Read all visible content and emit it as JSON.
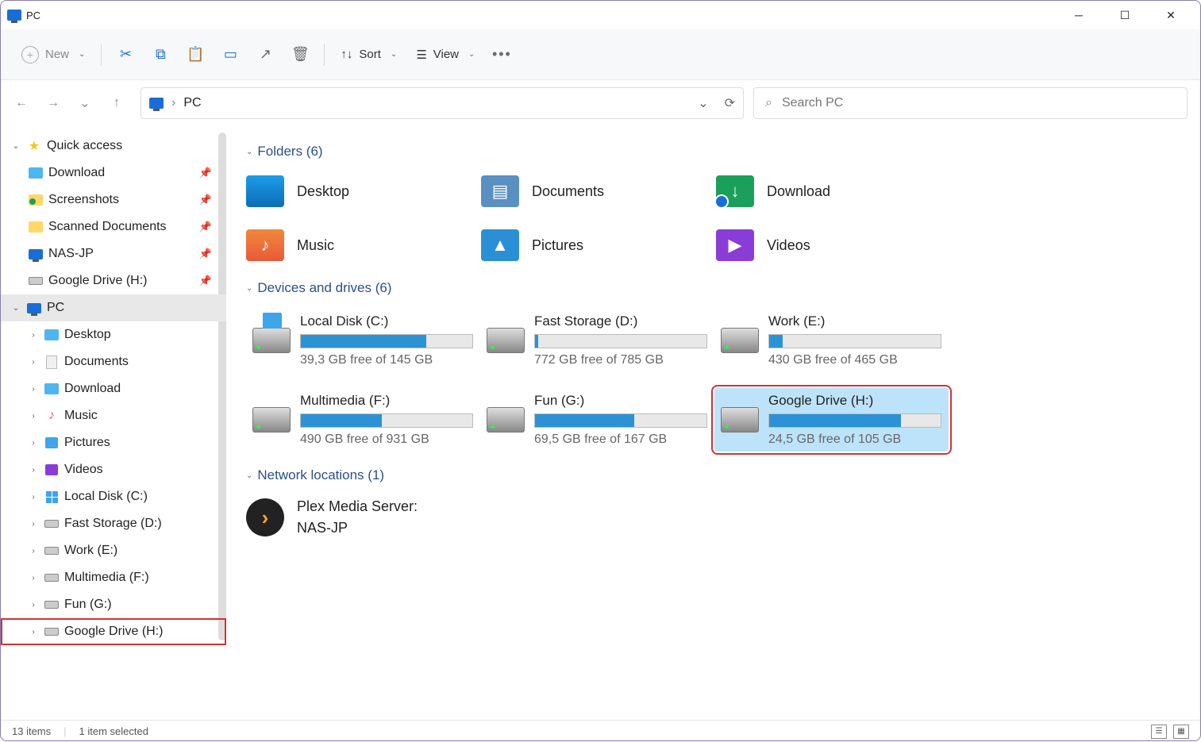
{
  "window": {
    "title": "PC"
  },
  "toolbar": {
    "new_label": "New",
    "sort_label": "Sort",
    "view_label": "View"
  },
  "address": {
    "location": "PC"
  },
  "search": {
    "placeholder": "Search PC"
  },
  "sidebar": {
    "quick_access": {
      "label": "Quick access",
      "items": [
        {
          "label": "Download"
        },
        {
          "label": "Screenshots"
        },
        {
          "label": "Scanned Documents"
        },
        {
          "label": "NAS-JP"
        },
        {
          "label": "Google Drive (H:)"
        }
      ]
    },
    "pc": {
      "label": "PC",
      "items": [
        {
          "label": "Desktop"
        },
        {
          "label": "Documents"
        },
        {
          "label": "Download"
        },
        {
          "label": "Music"
        },
        {
          "label": "Pictures"
        },
        {
          "label": "Videos"
        },
        {
          "label": "Local Disk (C:)"
        },
        {
          "label": "Fast Storage (D:)"
        },
        {
          "label": "Work (E:)"
        },
        {
          "label": "Multimedia (F:)"
        },
        {
          "label": "Fun (G:)"
        },
        {
          "label": "Google Drive (H:)"
        }
      ]
    }
  },
  "groups": {
    "folders": {
      "header": "Folders (6)",
      "items": [
        "Desktop",
        "Documents",
        "Download",
        "Music",
        "Pictures",
        "Videos"
      ]
    },
    "drives": {
      "header": "Devices and drives (6)",
      "items": [
        {
          "name": "Local Disk (C:)",
          "free": "39,3 GB free of 145 GB",
          "fill": 73
        },
        {
          "name": "Fast Storage (D:)",
          "free": "772 GB free of 785 GB",
          "fill": 2
        },
        {
          "name": "Work (E:)",
          "free": "430 GB free of 465 GB",
          "fill": 8
        },
        {
          "name": "Multimedia (F:)",
          "free": "490 GB free of 931 GB",
          "fill": 47
        },
        {
          "name": "Fun (G:)",
          "free": "69,5 GB free of 167 GB",
          "fill": 58
        },
        {
          "name": "Google Drive (H:)",
          "free": "24,5 GB free of 105 GB",
          "fill": 77,
          "selected": true
        }
      ]
    },
    "network": {
      "header": "Network locations (1)",
      "item": {
        "line1": "Plex Media Server:",
        "line2": "NAS-JP"
      }
    }
  },
  "status": {
    "count": "13 items",
    "selection": "1 item selected"
  }
}
